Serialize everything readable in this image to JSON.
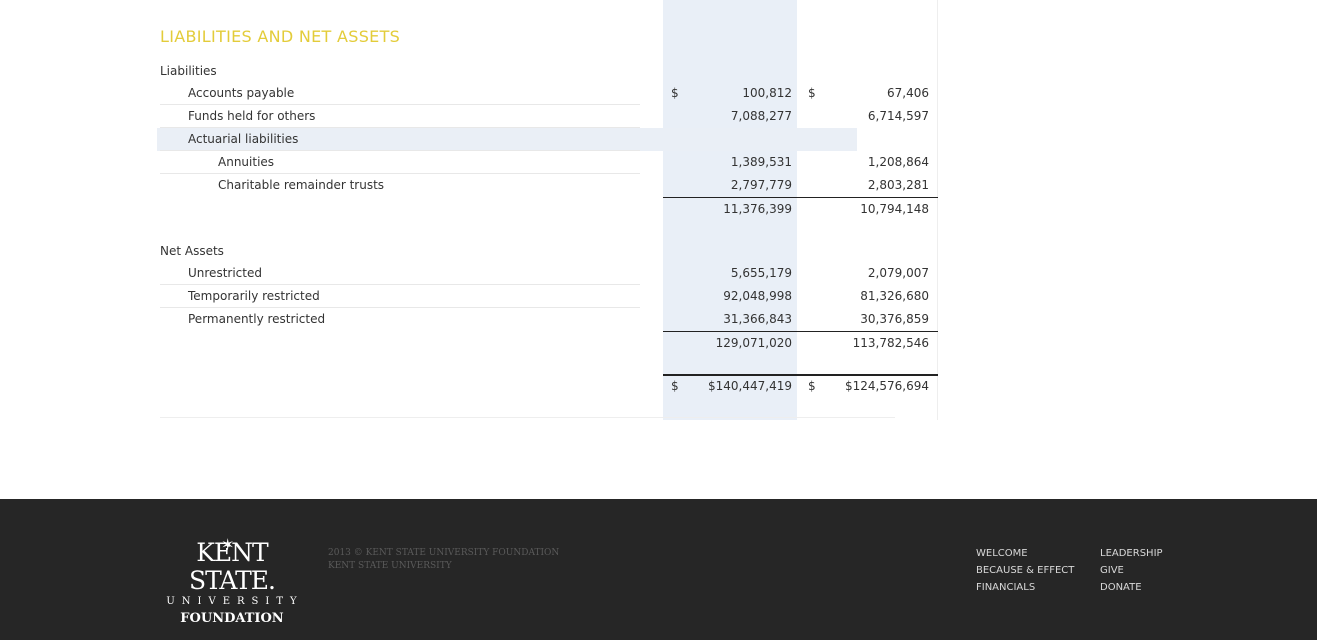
{
  "section_title": "LIABILITIES AND NET ASSETS",
  "liabilities": {
    "heading": "Liabilities",
    "rows": [
      {
        "label": "Accounts payable",
        "cur1": "$",
        "v1": "100,812",
        "cur2": "$",
        "v2": "67,406"
      },
      {
        "label": "Funds held for others",
        "v1": "7,088,277",
        "v2": "6,714,597"
      },
      {
        "label": "Actuarial liabilities"
      },
      {
        "label": "Annuities",
        "v1": "1,389,531",
        "v2": "1,208,864"
      },
      {
        "label": "Charitable remainder trusts",
        "v1": "2,797,779",
        "v2": "2,803,281"
      }
    ],
    "total_v1": "11,376,399",
    "total_v2": "10,794,148"
  },
  "net_assets": {
    "heading": "Net Assets",
    "rows": [
      {
        "label": "Unrestricted",
        "v1": "5,655,179",
        "v2": "2,079,007"
      },
      {
        "label": "Temporarily restricted",
        "v1": "92,048,998",
        "v2": "81,326,680"
      },
      {
        "label": "Permanently restricted",
        "v1": "31,366,843",
        "v2": "30,376,859"
      }
    ],
    "total_v1": "129,071,020",
    "total_v2": "113,782,546"
  },
  "grand_total": {
    "cur1": "$",
    "v1": "$140,447,419",
    "cur2": "$",
    "v2": "$124,576,694"
  },
  "footer": {
    "logo_main": "KENT STATE.",
    "logo_sub": "UNIVERSITY",
    "logo_foundation": "FOUNDATION",
    "copyright_line1": "2013 © KENT STATE UNIVERSITY FOUNDATION",
    "copyright_line2": "KENT STATE UNIVERSITY",
    "nav_col1": [
      "WELCOME",
      "BECAUSE & EFFECT",
      "FINANCIALS"
    ],
    "nav_col2": [
      "LEADERSHIP",
      "GIVE",
      "DONATE"
    ]
  }
}
